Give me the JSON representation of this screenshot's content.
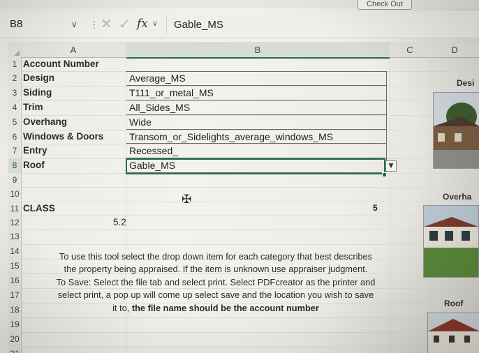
{
  "topbar": {
    "checkout_label": "Check Out"
  },
  "formula_bar": {
    "name_box": "B8",
    "fx_label": "fx",
    "value": "Gable_MS"
  },
  "columns": [
    "A",
    "B",
    "C",
    "D"
  ],
  "rows": [
    {
      "num": "1",
      "a": "Account Number",
      "b": ""
    },
    {
      "num": "2",
      "a": "Design",
      "b": "Average_MS"
    },
    {
      "num": "3",
      "a": "Siding",
      "b": "T111_or_metal_MS"
    },
    {
      "num": "4",
      "a": "Trim",
      "b": "All_Sides_MS"
    },
    {
      "num": "5",
      "a": "Overhang",
      "b": "Wide"
    },
    {
      "num": "6",
      "a": "Windows & Doors",
      "b": "Transom_or_Sidelights_average_windows_MS"
    },
    {
      "num": "7",
      "a": "Entry",
      "b": "Recessed_"
    },
    {
      "num": "8",
      "a": "Roof",
      "b": "Gable_MS"
    },
    {
      "num": "9",
      "a": "",
      "b": ""
    },
    {
      "num": "10",
      "a": "",
      "b": ""
    },
    {
      "num": "11",
      "a": "CLASS",
      "b": "5"
    },
    {
      "num": "12",
      "a": "5.2",
      "b": ""
    },
    {
      "num": "13",
      "a": "",
      "b": ""
    },
    {
      "num": "14",
      "a": "",
      "b": ""
    },
    {
      "num": "15",
      "a": "",
      "b": ""
    },
    {
      "num": "16",
      "a": "",
      "b": ""
    },
    {
      "num": "17",
      "a": "",
      "b": ""
    },
    {
      "num": "18",
      "a": "",
      "b": ""
    },
    {
      "num": "19",
      "a": "",
      "b": ""
    },
    {
      "num": "20",
      "a": "",
      "b": ""
    },
    {
      "num": "21",
      "a": "",
      "b": ""
    }
  ],
  "instructions": {
    "line1": "To use this tool select the drop down item for each category that best describes",
    "line2": "the property being appraised.  If the item is unknown use appraiser judgment.",
    "line3": "To Save: Select the file tab and select print.  Select PDFcreator as the printer and",
    "line4": "select print, a pop up will come up select save and the location you wish to save",
    "line5_plain": "it to, ",
    "line5_bold": "the file name should be the account number"
  },
  "right_labels": {
    "design": "Desi",
    "overhang": "Overha",
    "roof": "Roof"
  },
  "colors": {
    "accent": "#217346"
  }
}
